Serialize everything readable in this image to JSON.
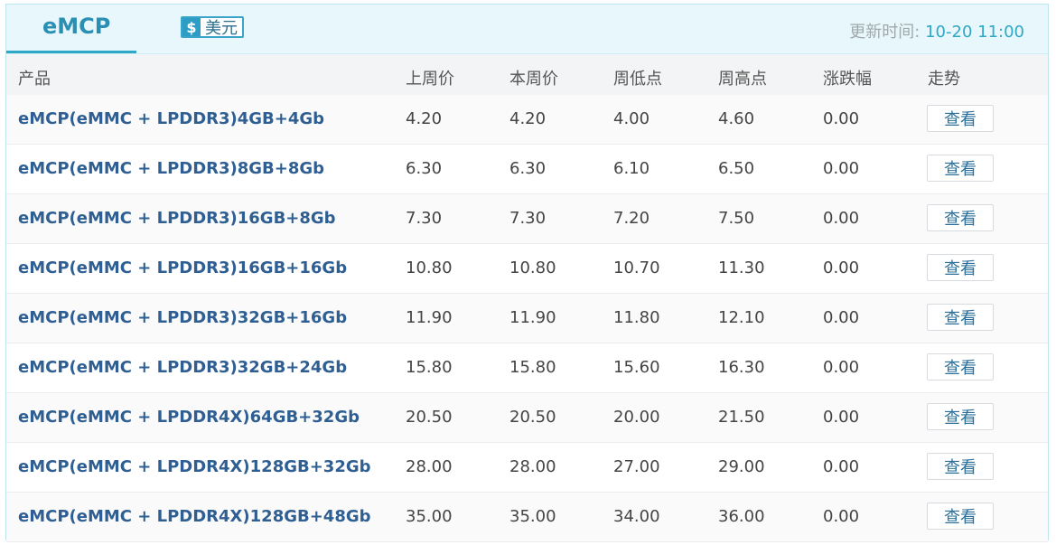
{
  "header": {
    "tab_title": "eMCP",
    "currency": {
      "symbol": "$",
      "label": "美元"
    },
    "update_label": "更新时间:",
    "update_time": "10-20 11:00"
  },
  "table": {
    "columns": [
      "产品",
      "上周价",
      "本周价",
      "周低点",
      "周高点",
      "涨跌幅",
      "走势"
    ],
    "view_label": "查看",
    "rows": [
      {
        "product": "eMCP(eMMC + LPDDR3)4GB+4Gb",
        "last_week": "4.20",
        "this_week": "4.20",
        "low": "4.00",
        "high": "4.60",
        "change": "0.00"
      },
      {
        "product": "eMCP(eMMC + LPDDR3)8GB+8Gb",
        "last_week": "6.30",
        "this_week": "6.30",
        "low": "6.10",
        "high": "6.50",
        "change": "0.00"
      },
      {
        "product": "eMCP(eMMC + LPDDR3)16GB+8Gb",
        "last_week": "7.30",
        "this_week": "7.30",
        "low": "7.20",
        "high": "7.50",
        "change": "0.00"
      },
      {
        "product": "eMCP(eMMC + LPDDR3)16GB+16Gb",
        "last_week": "10.80",
        "this_week": "10.80",
        "low": "10.70",
        "high": "11.30",
        "change": "0.00"
      },
      {
        "product": "eMCP(eMMC + LPDDR3)32GB+16Gb",
        "last_week": "11.90",
        "this_week": "11.90",
        "low": "11.80",
        "high": "12.10",
        "change": "0.00"
      },
      {
        "product": "eMCP(eMMC + LPDDR3)32GB+24Gb",
        "last_week": "15.80",
        "this_week": "15.80",
        "low": "15.60",
        "high": "16.30",
        "change": "0.00"
      },
      {
        "product": "eMCP(eMMC + LPDDR4X)64GB+32Gb",
        "last_week": "20.50",
        "this_week": "20.50",
        "low": "20.00",
        "high": "21.50",
        "change": "0.00"
      },
      {
        "product": "eMCP(eMMC + LPDDR4X)128GB+32Gb",
        "last_week": "28.00",
        "this_week": "28.00",
        "low": "27.00",
        "high": "29.00",
        "change": "0.00"
      },
      {
        "product": "eMCP(eMMC + LPDDR4X)128GB+48Gb",
        "last_week": "35.00",
        "this_week": "35.00",
        "low": "34.00",
        "high": "36.00",
        "change": "0.00"
      }
    ]
  }
}
